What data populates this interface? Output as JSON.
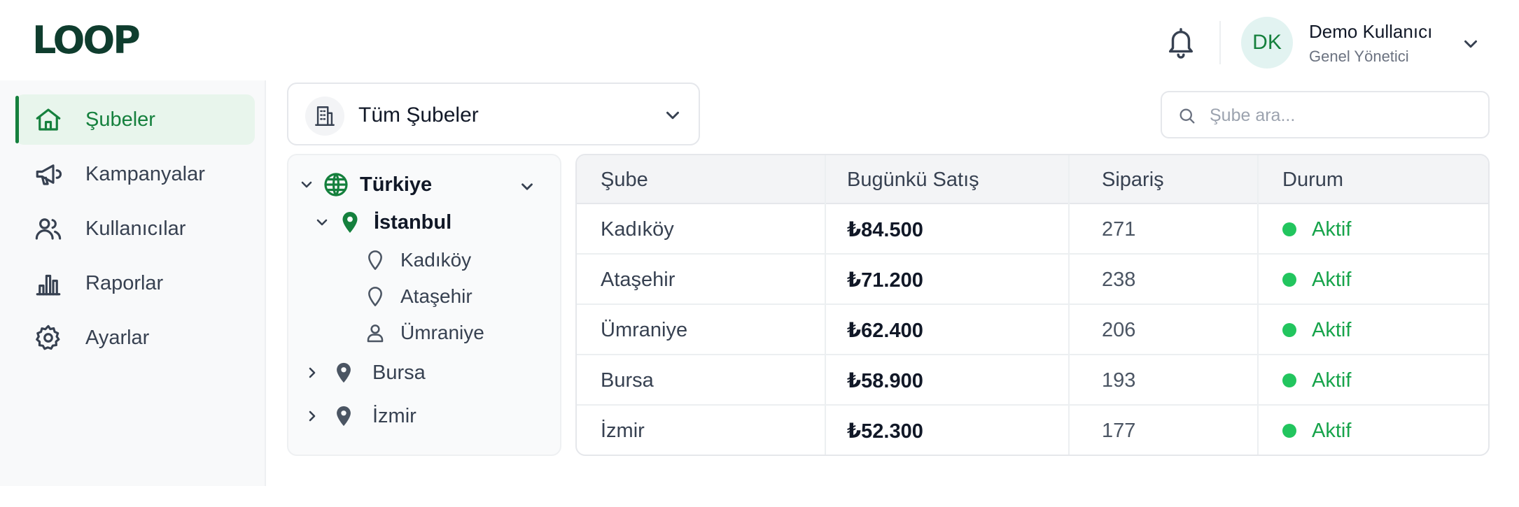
{
  "app": {
    "logo": "LOOP"
  },
  "user": {
    "initials": "DK",
    "name": "Demo Kullanıcı",
    "role": "Genel Yönetici"
  },
  "sidebar": {
    "items": [
      {
        "label": "Şubeler",
        "icon": "home-icon",
        "active": true
      },
      {
        "label": "Kampanyalar",
        "icon": "megaphone-icon",
        "active": false
      },
      {
        "label": "Kullanıcılar",
        "icon": "users-icon",
        "active": false
      },
      {
        "label": "Raporlar",
        "icon": "bar-chart-icon",
        "active": false
      },
      {
        "label": "Ayarlar",
        "icon": "gear-icon",
        "active": false
      }
    ]
  },
  "branch_select": {
    "value": "Tüm Şubeler",
    "icon": "building-icon"
  },
  "search": {
    "placeholder": "Şube ara..."
  },
  "tree": {
    "root": {
      "label": "Türkiye",
      "icon": "globe-icon",
      "expanded": true
    },
    "cities": [
      {
        "label": "İstanbul",
        "expanded": true,
        "children": [
          {
            "label": "Kadıköy",
            "icon": "map-pin-outline-icon"
          },
          {
            "label": "Ataşehir",
            "icon": "map-pin-outline-icon"
          },
          {
            "label": "Ümraniye",
            "icon": "user-icon"
          }
        ]
      },
      {
        "label": "Bursa",
        "expanded": false
      },
      {
        "label": "İzmir",
        "expanded": false
      }
    ]
  },
  "table": {
    "columns": [
      "Şube",
      "Bugünkü Satış",
      "Sipariş",
      "Durum"
    ],
    "rows": [
      {
        "branch": "Kadıköy",
        "sales": "₺84.500",
        "orders": "271",
        "status": "Aktif"
      },
      {
        "branch": "Ataşehir",
        "sales": "₺71.200",
        "orders": "238",
        "status": "Aktif"
      },
      {
        "branch": "Ümraniye",
        "sales": "₺62.400",
        "orders": "206",
        "status": "Aktif"
      },
      {
        "branch": "Bursa",
        "sales": "₺58.900",
        "orders": "193",
        "status": "Aktif"
      },
      {
        "branch": "İzmir",
        "sales": "₺52.300",
        "orders": "177",
        "status": "Aktif"
      }
    ]
  },
  "colors": {
    "brand": "#0f3d2e",
    "accent": "#15803d",
    "status_active": "#22c55e"
  }
}
